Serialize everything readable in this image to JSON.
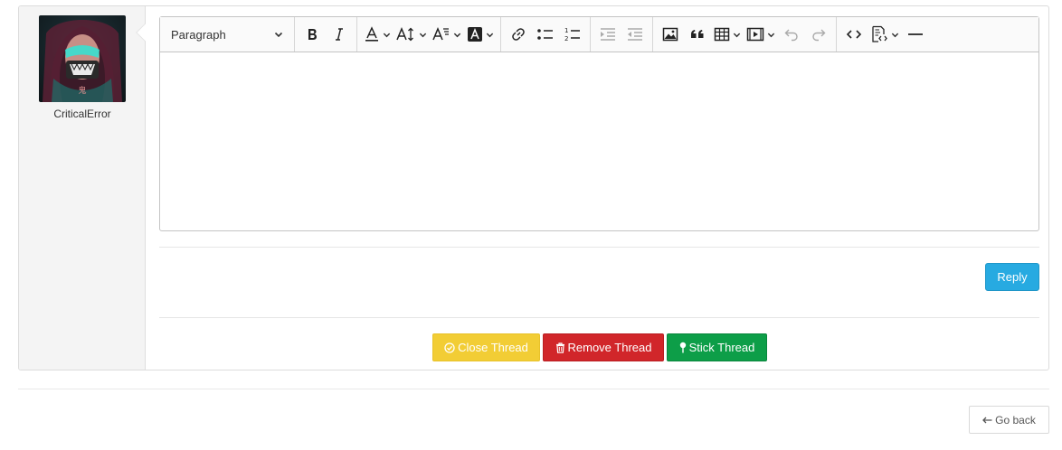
{
  "user": {
    "username": "CriticalError",
    "avatar_glyph": "鬼"
  },
  "editor": {
    "paragraph_select": "Paragraph",
    "toolbar_icons": [
      "bold-icon",
      "italic-icon",
      "font-color-icon",
      "font-size-icon",
      "font-family-icon",
      "highlight-icon",
      "link-icon",
      "bulleted-list-icon",
      "numbered-list-icon",
      "outdent-icon",
      "indent-icon",
      "image-icon",
      "blockquote-icon",
      "table-icon",
      "media-icon",
      "undo-icon",
      "redo-icon",
      "code-icon",
      "source-icon",
      "horizontal-line-icon"
    ],
    "content": ""
  },
  "actions": {
    "reply_label": "Reply",
    "close_thread_label": "Close Thread",
    "remove_thread_label": "Remove Thread",
    "stick_thread_label": "Stick Thread",
    "go_back_label": "Go back"
  },
  "colors": {
    "reply": "#27aae1",
    "close_thread": "#f2cd35",
    "remove_thread": "#d1262a",
    "stick_thread": "#0d9e48"
  }
}
